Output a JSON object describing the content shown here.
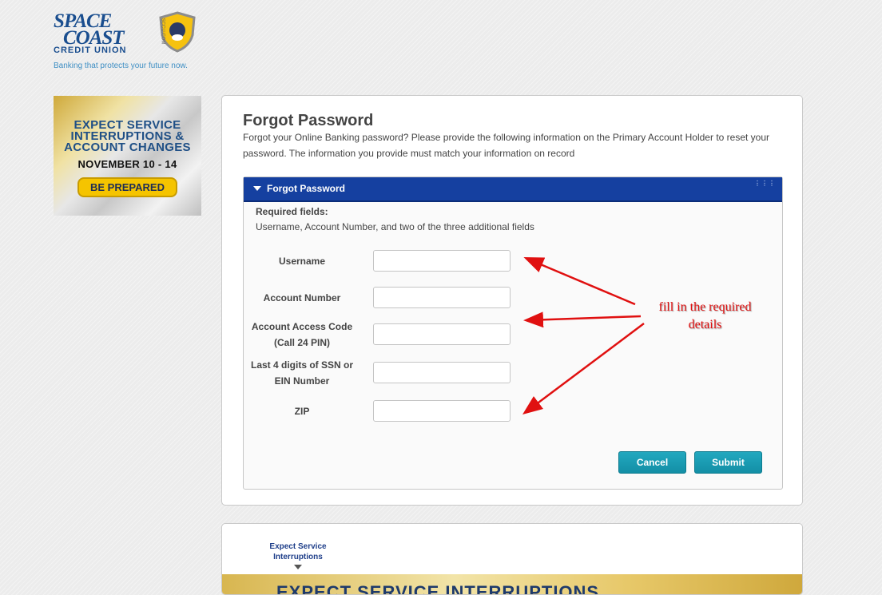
{
  "brand": {
    "line1": "SPACE",
    "line2": "COAST",
    "line3": "CREDIT UNION",
    "tagline": "Banking that protects your future now.",
    "shield_text": "SCCU.COM"
  },
  "ad": {
    "line1": "EXPECT SERVICE",
    "line2": "INTERRUPTIONS &",
    "line3": "ACCOUNT CHANGES",
    "date": "NOVEMBER 10 - 14",
    "cta": "BE PREPARED"
  },
  "main": {
    "title": "Forgot Password",
    "description": "Forgot your Online Banking password? Please provide the following information on the Primary Account Holder to reset your password. The information you provide must match your information on record",
    "form": {
      "header": "Forgot Password",
      "required_heading": "Required fields:",
      "required_text": "Username, Account Number, and two of the three additional fields",
      "fields": [
        {
          "label_line1": "Username",
          "label_line2": "",
          "value": ""
        },
        {
          "label_line1": "Account Number",
          "label_line2": "",
          "value": ""
        },
        {
          "label_line1": "Account Access Code",
          "label_line2": "(Call 24 PIN)",
          "value": ""
        },
        {
          "label_line1": "Last 4 digits of SSN or",
          "label_line2": "EIN Number",
          "value": ""
        },
        {
          "label_line1": "ZIP",
          "label_line2": "",
          "value": ""
        }
      ],
      "cancel_label": "Cancel",
      "submit_label": "Submit"
    }
  },
  "bottom": {
    "tab_label": "Expect Service Interruptions",
    "banner_text": "EXPECT SERVICE INTERRUPTIONS"
  },
  "annotation": {
    "line1": "fill in the required",
    "line2": "details",
    "color": "#e01010"
  },
  "colors": {
    "header_bar": "#1540a0",
    "button": "#1a9bb3",
    "brand": "#1a4e8f"
  }
}
